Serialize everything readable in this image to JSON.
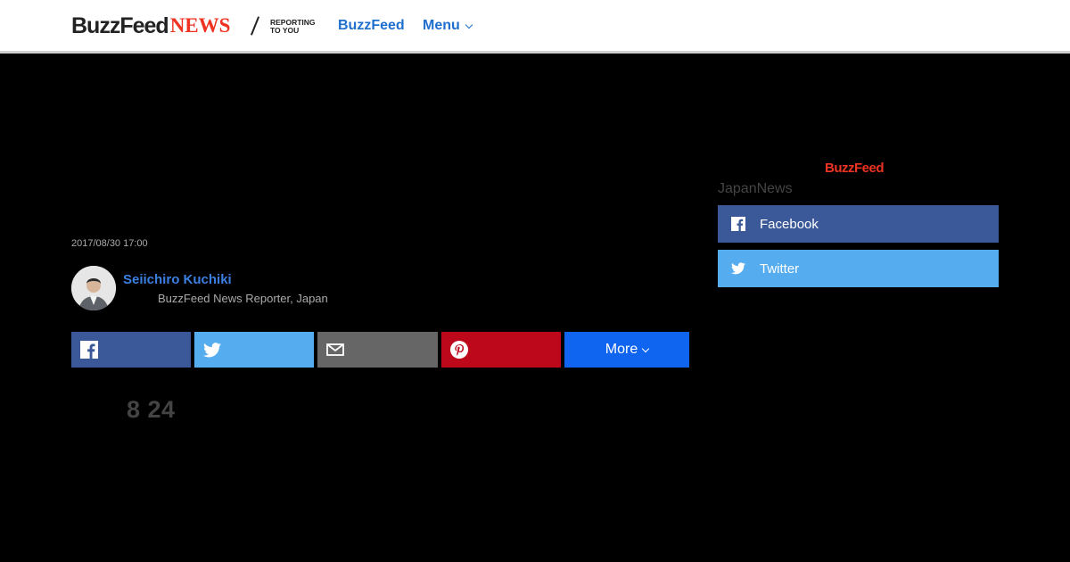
{
  "header": {
    "logo_buzzfeed": "BuzzFeed",
    "logo_news": "NEWS",
    "tagline_line1": "REPORTING",
    "tagline_line2": "TO YOU",
    "nav_buzzfeed": "BuzzFeed",
    "nav_menu": "Menu"
  },
  "article": {
    "timestamp": "2017/08/30 17:00",
    "author_name": "Seiichiro Kuchiki",
    "author_title": "BuzzFeed News Reporter, Japan",
    "date_big": "8  24"
  },
  "share": {
    "facebook_icon": "facebook-icon",
    "twitter_icon": "twitter-icon",
    "mail_icon": "mail-icon",
    "pinterest_icon": "pinterest-icon",
    "more_label": "More"
  },
  "sidebar": {
    "logo": "BuzzFeed",
    "label": "JapanNews",
    "facebook_label": "Facebook",
    "twitter_label": "Twitter"
  },
  "colors": {
    "background": "#000000",
    "facebook": "#3b5998",
    "twitter": "#55acee",
    "mail": "#666666",
    "pinterest": "#bd081c",
    "more": "#0f65ef",
    "link": "#1f6fcf",
    "brand_red": "#ee3322"
  }
}
